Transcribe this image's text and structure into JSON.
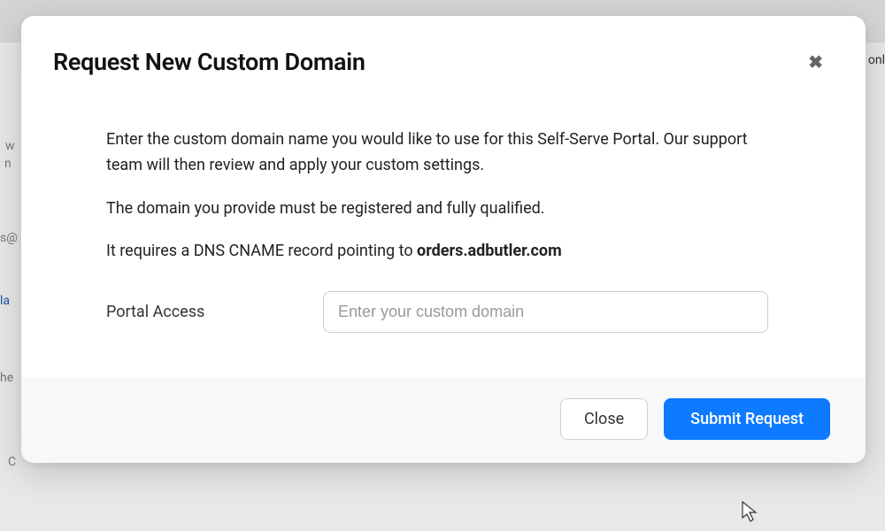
{
  "modal": {
    "title": "Request New Custom Domain",
    "paragraph1": "Enter the custom domain name you would like to use for this Self-Serve Portal. Our support team will then review and apply your custom settings.",
    "paragraph2": "The domain you provide must be registered and fully qualified.",
    "paragraph3_prefix": "It requires a DNS CNAME record pointing to ",
    "paragraph3_strong": "orders.adbutler.com",
    "form": {
      "label": "Portal Access",
      "placeholder": "Enter your custom domain",
      "value": ""
    },
    "footer": {
      "close": "Close",
      "submit": "Submit Request"
    }
  },
  "backdrop": {
    "snip1": "w",
    "snip2": "n",
    "snip3": "s@",
    "snip4": "la",
    "snip5": "he",
    "snip6": "C",
    "snip7": "onl"
  }
}
